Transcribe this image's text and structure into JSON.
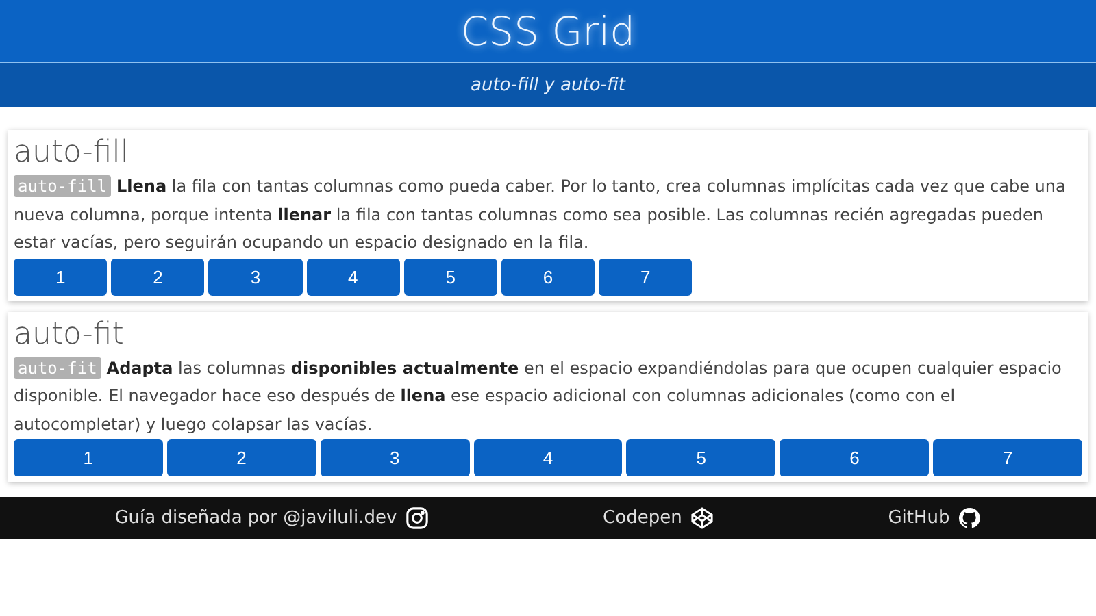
{
  "header": {
    "title": "CSS Grid",
    "subtitle": "auto-fill y auto-fit"
  },
  "sections": [
    {
      "kind": "fill",
      "title": "auto-fill",
      "code": "auto-fill",
      "text": "**Llena** la fila con tantas columnas como pueda caber. Por lo tanto, crea columnas implícitas cada vez que cabe una nueva columna, porque intenta **llenar** la fila con tantas columnas como sea posible. Las columnas recién agregadas pueden estar vacías, pero seguirán ocupando un espacio designado en la fila.",
      "items": [
        "1",
        "2",
        "3",
        "4",
        "5",
        "6",
        "7"
      ]
    },
    {
      "kind": "fit",
      "title": "auto-fit",
      "code": "auto-fit",
      "text": "**Adapta** las columnas **disponibles actualmente** en el espacio expandiéndolas para que ocupen cualquier espacio disponible. El navegador hace eso después de **llena** ese espacio adicional con columnas adicionales (como con el autocompletar) y luego colapsar las vacías.",
      "items": [
        "1",
        "2",
        "3",
        "4",
        "5",
        "6",
        "7"
      ]
    }
  ],
  "footer": [
    {
      "kind": "instagram",
      "label": "Guía diseñada por @javiluli.dev"
    },
    {
      "kind": "codepen",
      "label": "Codepen"
    },
    {
      "kind": "github",
      "label": "GitHub"
    }
  ]
}
